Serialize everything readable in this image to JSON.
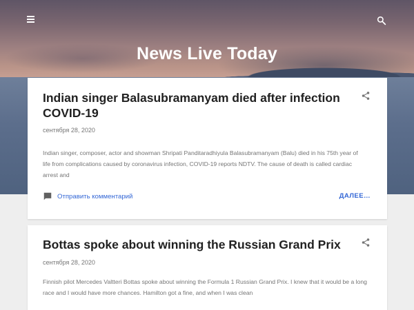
{
  "header": {
    "site_title": "News Live Today",
    "menu_icon": "hamburger-menu-icon",
    "search_icon": "search-icon"
  },
  "posts": [
    {
      "title": "Indian singer Balasubramanyam died after infection COVID-19",
      "date": "сентября 28, 2020",
      "snippet": "Indian singer, composer, actor and showman Shripati Panditaradhiyula Balasubramanyam (Balu) died in his 75th year of life from complications caused by coronavirus infection, COVID-19 reports NDTV. The cause of death is called cardiac arrest and",
      "comment_label": "Отправить комментарий",
      "more_label": "ДАЛЕЕ…"
    },
    {
      "title": "Bottas spoke about winning the Russian Grand Prix",
      "date": "сентября 28, 2020",
      "snippet": "Finnish pilot Mercedes Valtteri Bottas spoke about winning the Formula 1 Russian Grand Prix. I knew that it would be a long race and I would have more chances. Hamilton got a fine, and when I was clean"
    }
  ],
  "colors": {
    "link": "#3367d6",
    "title_text": "#212121",
    "meta_text": "#757575",
    "page_bg": "#eeeeee"
  }
}
